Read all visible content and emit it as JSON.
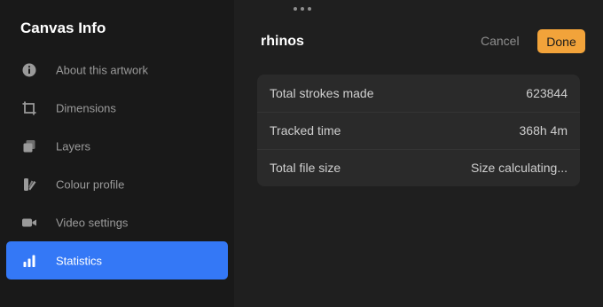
{
  "sidebar": {
    "title": "Canvas Info",
    "items": [
      {
        "label": "About this artwork",
        "icon": "info-icon"
      },
      {
        "label": "Dimensions",
        "icon": "crop-icon"
      },
      {
        "label": "Layers",
        "icon": "layers-icon"
      },
      {
        "label": "Colour profile",
        "icon": "swatch-icon"
      },
      {
        "label": "Video settings",
        "icon": "video-camera-icon"
      },
      {
        "label": "Statistics",
        "icon": "bar-chart-icon",
        "active": true
      }
    ]
  },
  "header": {
    "title": "rhinos",
    "cancel_label": "Cancel",
    "done_label": "Done"
  },
  "stats": [
    {
      "label": "Total strokes made",
      "value": "623844"
    },
    {
      "label": "Tracked time",
      "value": "368h 4m"
    },
    {
      "label": "Total file size",
      "value": "Size calculating..."
    }
  ],
  "colors": {
    "accent": "#3478f6",
    "done": "#f2a33a",
    "sidebar_bg": "#191919",
    "main_bg": "#1f1f1f",
    "card_bg": "#2a2a2a"
  }
}
